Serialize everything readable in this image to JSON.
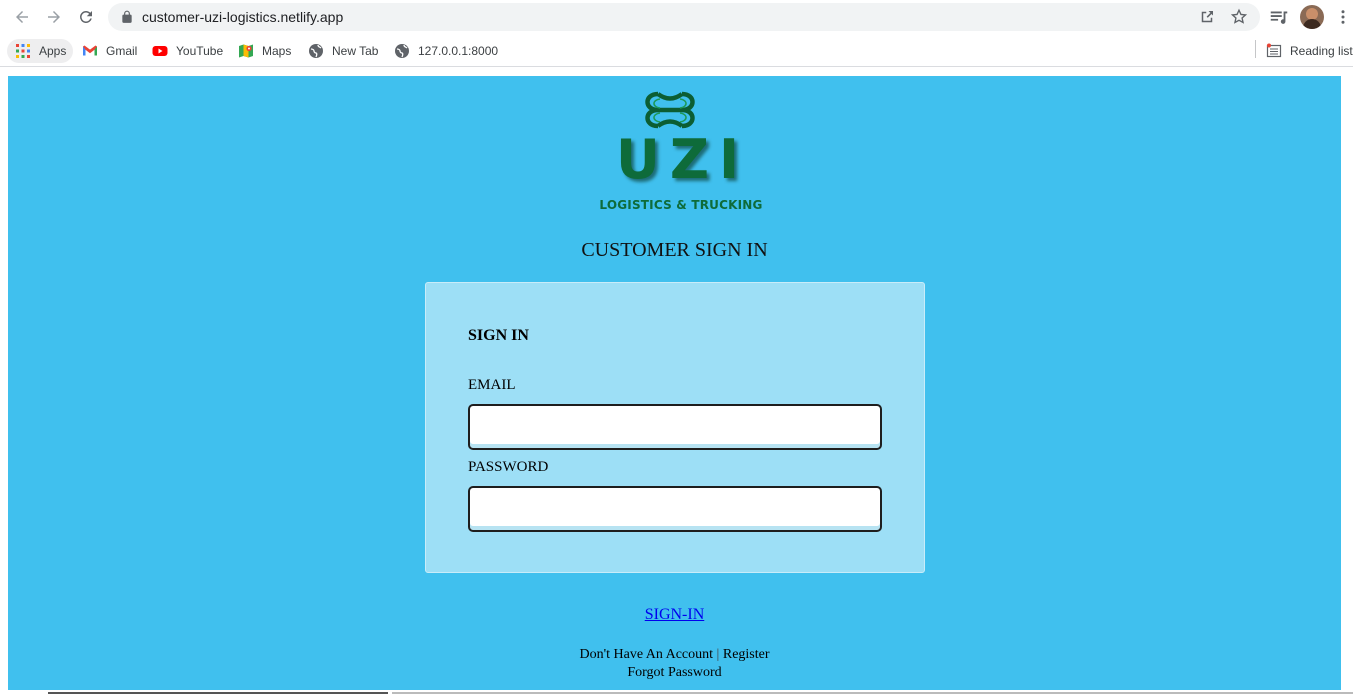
{
  "browser": {
    "url": "customer-uzi-logistics.netlify.app",
    "icons": {
      "back": "arrow-left-icon",
      "forward": "arrow-right-icon",
      "reload": "reload-icon",
      "lock": "lock-icon",
      "share": "share-icon",
      "bookmark_star": "star-icon",
      "media": "media-queue-icon",
      "profile": "avatar",
      "menu": "kebab-menu-icon"
    },
    "bookmarks": [
      {
        "label": "Apps",
        "icon": "apps-grid-icon"
      },
      {
        "label": "Gmail",
        "icon": "gmail-icon"
      },
      {
        "label": "YouTube",
        "icon": "youtube-icon"
      },
      {
        "label": "Maps",
        "icon": "maps-icon"
      },
      {
        "label": "New Tab",
        "icon": "globe-icon"
      },
      {
        "label": "127.0.0.1:8000",
        "icon": "globe-icon"
      }
    ],
    "reading_list": "Reading list"
  },
  "page": {
    "background": "#40c0ee",
    "logo": {
      "brand": "UZI",
      "tagline": "LOGISTICS & TRUCKING",
      "color": "#0e6b3a"
    },
    "title": "CUSTOMER SIGN IN",
    "form": {
      "heading": "SIGN IN",
      "email_label": "EMAIL",
      "email_value": "",
      "password_label": "PASSWORD",
      "password_value": ""
    },
    "submit_link": "SIGN-IN",
    "footer": {
      "no_account": "Don't Have An Account",
      "separator": "|",
      "register": "Register",
      "forgot": "Forgot Password"
    }
  }
}
